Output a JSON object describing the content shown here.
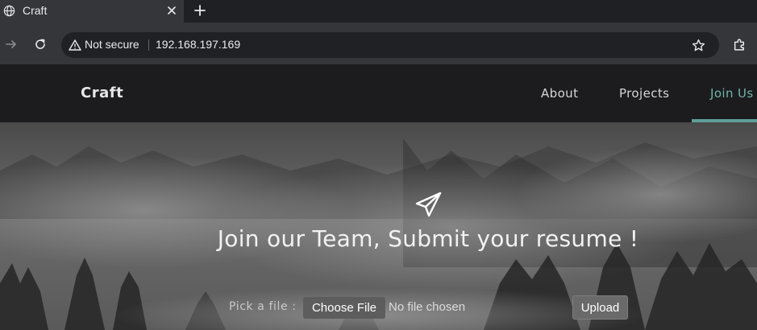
{
  "browser": {
    "tab_title": "Craft",
    "security_label": "Not secure",
    "url": "192.168.197.169",
    "icons": [
      "globe-icon",
      "close-icon",
      "plus-icon",
      "forward-arrow-icon",
      "reload-icon",
      "warning-icon",
      "star-icon",
      "extensions-icon"
    ]
  },
  "site": {
    "brand": "Craft",
    "nav": {
      "about": "About",
      "projects": "Projects",
      "join_us": "Join Us"
    },
    "active_nav": "join_us",
    "accent_color": "#5e9e96"
  },
  "hero": {
    "icon": "paper-plane-icon",
    "title": "Join our Team, Submit your resume !",
    "upload_form": {
      "pick_label": "Pick a file :",
      "choose_button": "Choose File",
      "file_status": "No file chosen",
      "submit_button": "Upload"
    }
  }
}
